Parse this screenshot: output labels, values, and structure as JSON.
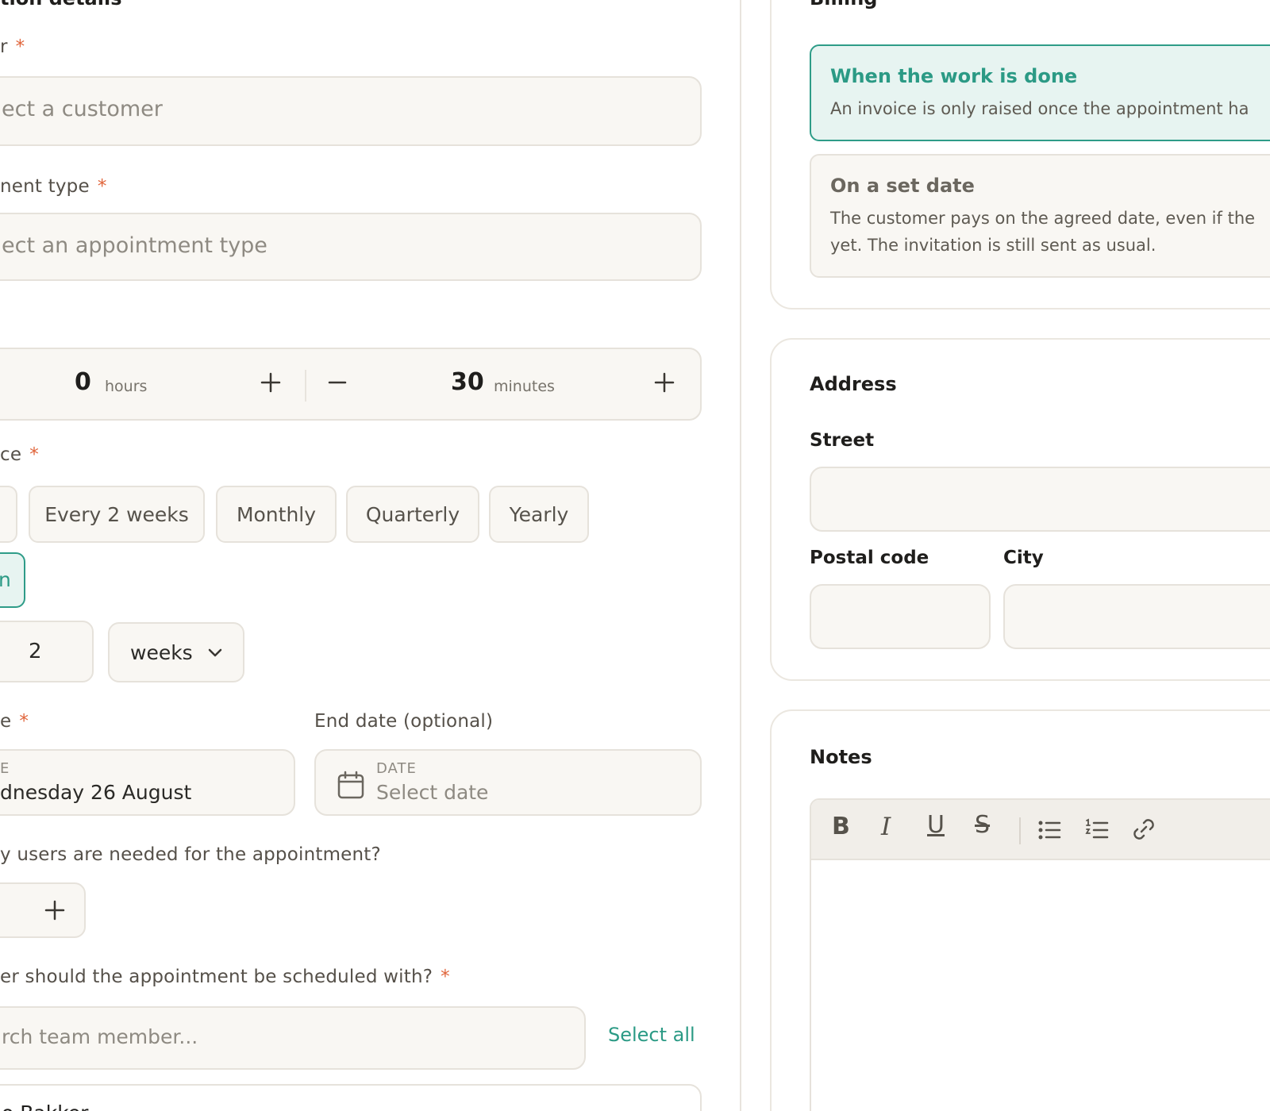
{
  "left": {
    "section_title": "tion details",
    "customer": {
      "label": "r",
      "placeholder": "ect a customer"
    },
    "appointment_type": {
      "label": "nent type",
      "placeholder": "ect an appointment type"
    },
    "duration": {
      "hours_value": "0",
      "hours_unit": "hours",
      "minutes_value": "30",
      "minutes_unit": "minutes"
    },
    "frequency": {
      "label": "ce",
      "options": [
        "Every 2 weeks",
        "Monthly",
        "Quarterly",
        "Yearly"
      ],
      "custom_option": "n",
      "custom_value": "2",
      "custom_unit": "weeks"
    },
    "start_date": {
      "label": "e",
      "field_label": "E",
      "value": "dnesday 26 August"
    },
    "end_date": {
      "label": "End date (optional)",
      "field_label": "DATE",
      "placeholder": "Select date"
    },
    "users_needed": {
      "label": "y users are needed for the appointment?"
    },
    "team": {
      "label": "er should the appointment be scheduled with?",
      "placeholder": "rch team member...",
      "select_all": "Select all",
      "first_member": "o Bakker"
    }
  },
  "right": {
    "billing": {
      "title": "Billing",
      "option_done_title": "When the work is done",
      "option_done_desc": "An invoice is only raised once the appointment ha",
      "option_date_title": "On a set date",
      "option_date_desc_1": "The customer pays on the agreed date, even if the",
      "option_date_desc_2": "yet. The invitation is still sent as usual."
    },
    "address": {
      "title": "Address",
      "street_label": "Street",
      "postal_label": "Postal code",
      "city_label": "City"
    },
    "notes": {
      "title": "Notes"
    }
  },
  "required_mark": "*",
  "colors": {
    "accent": "#2b9a85",
    "required": "#e0643a",
    "field_bg": "#f9f7f3"
  }
}
